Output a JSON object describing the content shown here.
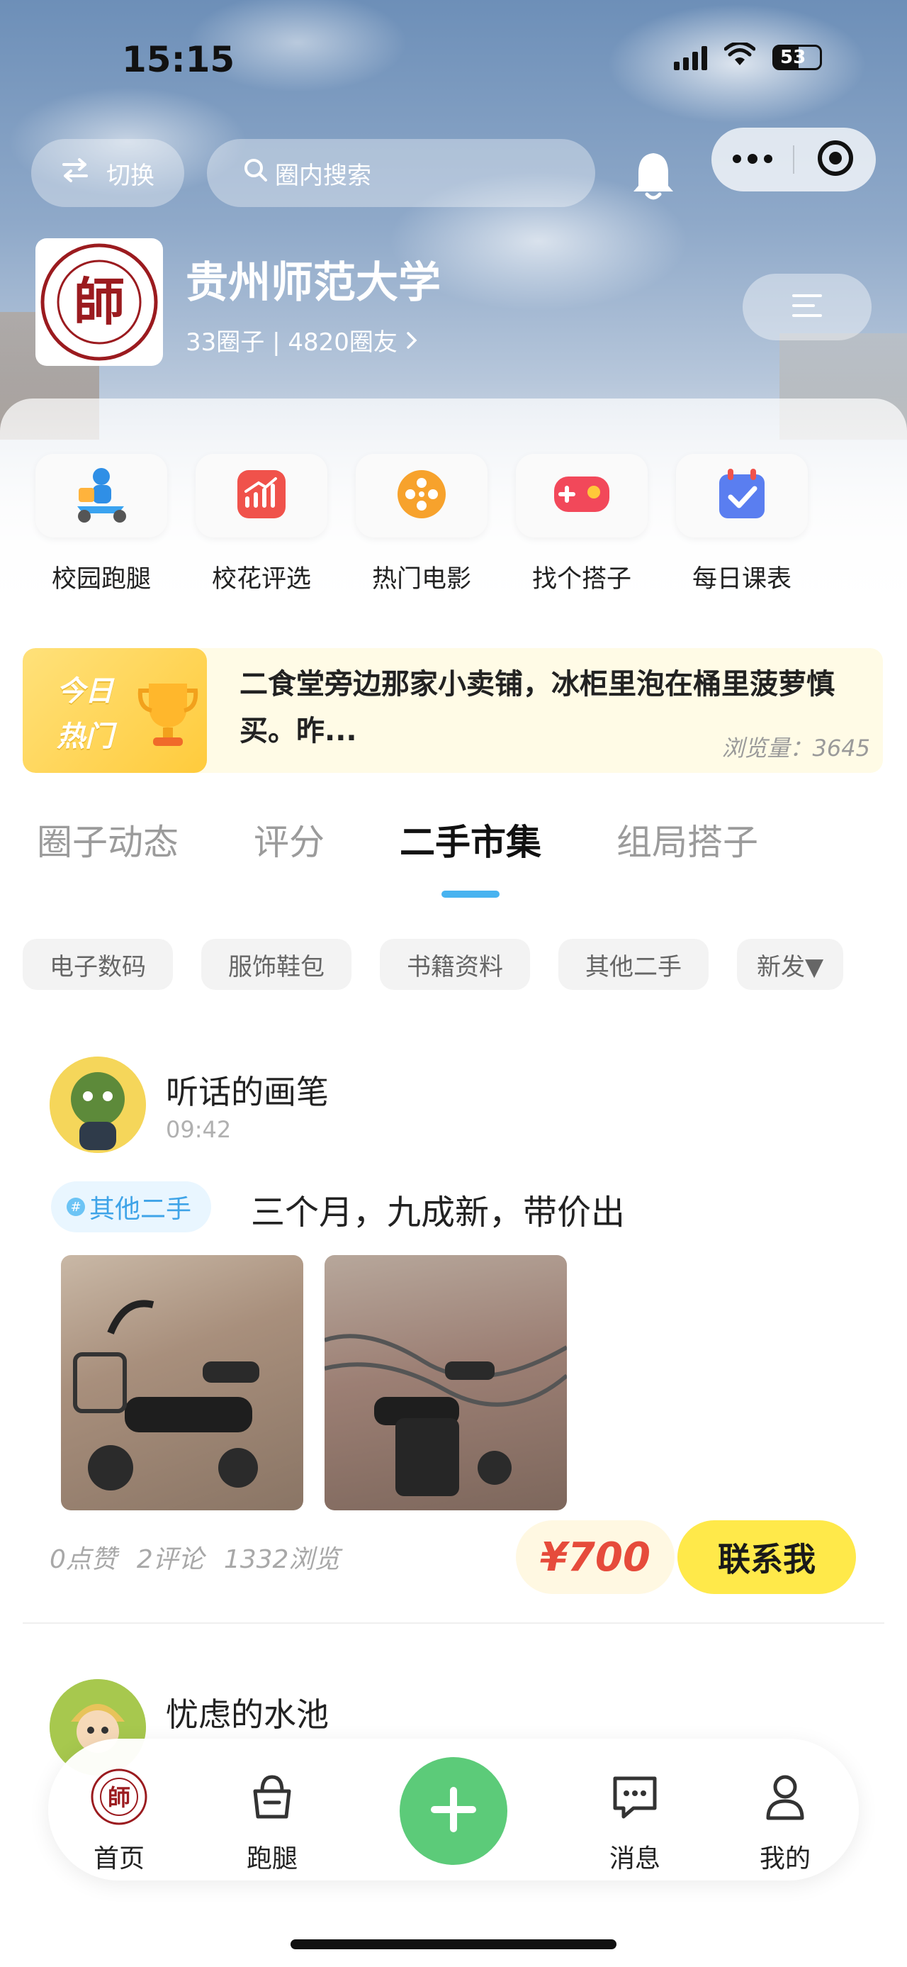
{
  "status_bar": {
    "time": "15:15",
    "battery": "53"
  },
  "top_bar": {
    "switch_label": "切换",
    "search_placeholder": "圈内搜索"
  },
  "university": {
    "name": "贵州师范大学",
    "circles": "33圈子",
    "separator": "|",
    "members": "4820圈友",
    "logo_char": "師"
  },
  "services": [
    {
      "label": "校园跑腿",
      "icon": "delivery-scooter-icon"
    },
    {
      "label": "校花评选",
      "icon": "rising-chart-icon"
    },
    {
      "label": "热门电影",
      "icon": "film-reel-icon"
    },
    {
      "label": "找个搭子",
      "icon": "game-controller-icon"
    },
    {
      "label": "每日课表",
      "icon": "calendar-check-icon"
    }
  ],
  "hot_banner": {
    "badge_line1": "今日",
    "badge_line2": "热门",
    "text": "二食堂旁边那家小卖铺，冰柜里泡在桶里菠萝慎买。昨...",
    "views": "浏览量：3645"
  },
  "tabs": [
    {
      "label": "圈子动态",
      "active": false
    },
    {
      "label": "评分",
      "active": false
    },
    {
      "label": "二手市集",
      "active": true
    },
    {
      "label": "组局搭子",
      "active": false
    }
  ],
  "filter_chips": [
    "电子数码",
    "服饰鞋包",
    "书籍资料",
    "其他二手"
  ],
  "sort_label": "新发▼",
  "posts": [
    {
      "author": "听话的画笔",
      "time": "09:42",
      "tag": "其他二手",
      "body": "三个月，九成新，带价出",
      "likes": "0点赞",
      "comments": "2评论",
      "views": "1332浏览",
      "price": "¥700",
      "contact": "联系我"
    },
    {
      "author": "忧虑的水池"
    }
  ],
  "bottom_nav": [
    {
      "label": "首页",
      "icon": "home-logo-icon"
    },
    {
      "label": "跑腿",
      "icon": "basket-icon"
    },
    {
      "label": "消息",
      "icon": "message-bubble-icon"
    },
    {
      "label": "我的",
      "icon": "person-icon"
    }
  ],
  "colors": {
    "accent_blue": "#48b3f0",
    "price_red": "#e64b3b",
    "contact_yellow": "#ffe94a",
    "fab_green": "#5ccb79"
  }
}
